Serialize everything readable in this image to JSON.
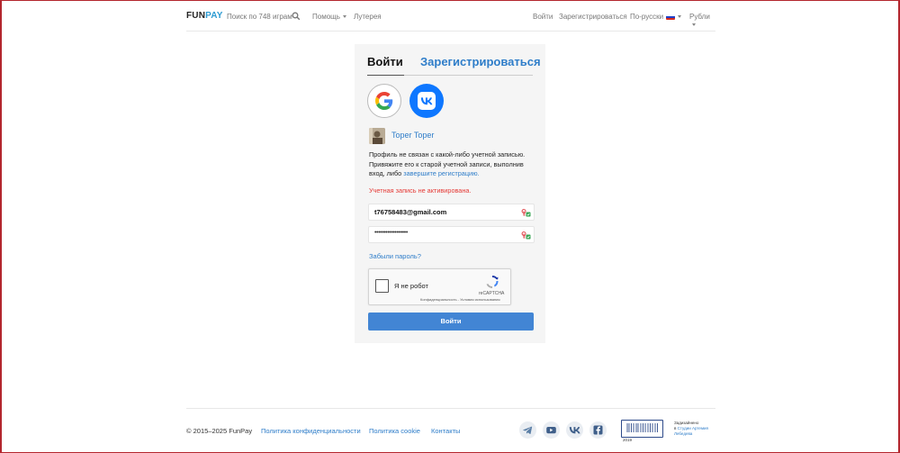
{
  "header": {
    "logo": {
      "part1": "FUN",
      "part2": "PAY"
    },
    "search_placeholder": "Поиск по 748 играм",
    "help_label": "Помощь",
    "lottery_label": "Лутерея",
    "login_label": "Войти",
    "register_label": "Зарегистрироваться",
    "language_label": "По-русски",
    "currency_label": "Рубли"
  },
  "auth": {
    "tab_login": "Войти",
    "tab_register": "Зарегистрироваться",
    "social": [
      "google-icon",
      "vk-icon"
    ],
    "username": "Toper Toper",
    "profile_message_line1": "Профиль не связан с какой-либо учетной записью.",
    "profile_message_line2": "Привяжите его к старой учетной записи, выполнив",
    "profile_message_line3_prefix": "вход, либо",
    "profile_message_link": "завершите регистрацию.",
    "error": "Учетная запись не активирована.",
    "email_value": "t76758483@gmail.com",
    "password_value": "••••••••••••••••••",
    "forgot_password": "Забыли пароль?",
    "captcha_label": "Я не робот",
    "captcha_brand": "reCAPTCHA",
    "captcha_terms": "Конфиденциальность - Условия использования",
    "submit_label": "Войти"
  },
  "footer": {
    "copyright": "© 2015–2025 FunPay",
    "links": [
      "Политика конфиденциальности",
      "Политика cookie",
      "Контакты"
    ],
    "social_icons": [
      "telegram-icon",
      "youtube-icon",
      "vk-icon",
      "facebook-icon"
    ],
    "studio_year": "2019",
    "studio_line1": "Задизайнено",
    "studio_prefix": "в",
    "studio_link1": "Студии Артемия",
    "studio_link2": "Лебедева"
  },
  "colors": {
    "accent": "#2e7dc9",
    "button": "#4285d4",
    "error": "#e53935",
    "frame": "#b3262e",
    "vk": "#0e77ff"
  }
}
